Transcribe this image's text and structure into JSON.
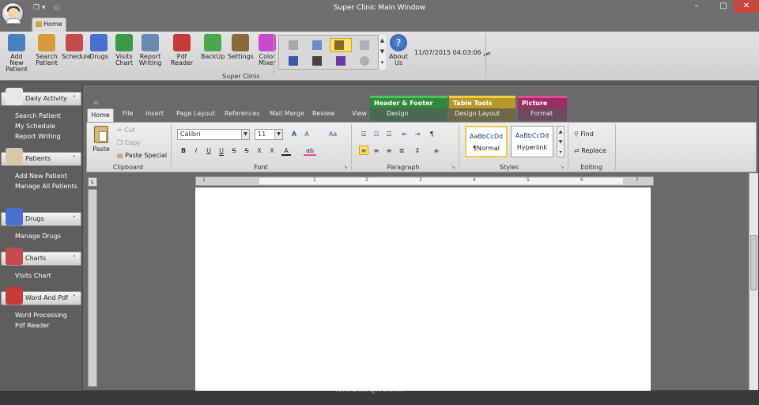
{
  "window": {
    "title": "Super Clinic Main Window",
    "home_tab": "Home",
    "minimize": "–",
    "maximize": "□",
    "close": "✕",
    "qat_icons": "❐ ▾",
    "qat_pin": "▫"
  },
  "ribbon": {
    "buttons": [
      {
        "label1": "Add New",
        "label2": "Patient",
        "icon": "add-patient-icon",
        "color": "#4a7fc1"
      },
      {
        "label1": "Search",
        "label2": "Patient",
        "icon": "search-patient-icon",
        "color": "#d89a3a"
      },
      {
        "label1": "Schedule",
        "label2": "",
        "icon": "calendar-icon",
        "color": "#c84a4a"
      },
      {
        "label1": "Drugs",
        "label2": "",
        "icon": "syringe-icon",
        "color": "#4a6fd1"
      },
      {
        "label1": "Visits",
        "label2": "Chart",
        "icon": "chart-icon",
        "color": "#3a9a4a"
      },
      {
        "label1": "Report",
        "label2": "Writing",
        "icon": "report-icon",
        "color": "#6a8ab0"
      },
      {
        "label1": "Pdf Reader",
        "label2": "",
        "icon": "pdf-icon",
        "color": "#c83a3a"
      },
      {
        "label1": "BackUp",
        "label2": "",
        "icon": "backup-icon",
        "color": "#4aa84a"
      },
      {
        "label1": "Settings",
        "label2": "",
        "icon": "settings-icon",
        "color": "#8a6a3a"
      },
      {
        "label1": "Color",
        "label2": "Mixer",
        "icon": "color-wheel-icon",
        "color": "#c84ac8"
      }
    ],
    "group_label": "Super Clinic",
    "about": {
      "label1": "About",
      "label2": "Us"
    },
    "datetime": "11/07/2015 04:03:06 ص",
    "scroll_up": "▲",
    "scroll_down": "▼",
    "scroll_more": "▾"
  },
  "sidebar": {
    "sections": [
      {
        "title": "Daily Activity",
        "items": [
          "Search Patient",
          "My Schedule",
          "Report Writing"
        ]
      },
      {
        "title": "Patients",
        "items": [
          "Add New Patient",
          "Manage All Patients"
        ]
      },
      {
        "title": "Drugs",
        "items": [
          "Manage Drugs"
        ]
      },
      {
        "title": "Charts",
        "items": [
          "Visits Chart"
        ]
      },
      {
        "title": "Word And Pdf",
        "items": [
          "Word Processing",
          "Pdf Reader"
        ]
      }
    ],
    "collapse_glyph": "˄"
  },
  "word": {
    "context_tabs": {
      "header_footer": "Header & Footer Tools",
      "table": "Table Tools",
      "picture": "Picture Tools"
    },
    "tabs": [
      "Home",
      "File",
      "Insert",
      "Page Layout",
      "References",
      "Mail Merge",
      "Review",
      "View",
      "Design",
      "Design",
      "Layout",
      "Format"
    ],
    "clipboard": {
      "paste": "Paste",
      "cut": "Cut",
      "copy": "Copy",
      "paste_special": "Paste Special",
      "label": "Clipboard"
    },
    "font": {
      "name": "Calibri",
      "size": "11",
      "label": "Font",
      "grow": "A",
      "shrink": "A",
      "case": "Aa",
      "bold": "B",
      "italic": "I",
      "underline": "U",
      "double_underline": "U",
      "strike": "S",
      "dstrike": "S",
      "sub": "X",
      "sup": "X",
      "font_color": "A",
      "highlight": "ab"
    },
    "paragraph": {
      "label": "Paragraph",
      "pilcrow": "¶"
    },
    "styles": {
      "normal_sample": "AaBbCcDd",
      "normal": "¶Normal",
      "hyperlink_sample": "AaBbCcDd",
      "hyperlink": "Hyperlink",
      "label": "Styles"
    },
    "editing": {
      "find": "Find",
      "replace": "Replace",
      "label": "Editing"
    },
    "ruler_corner": "L",
    "ruler_numbers": [
      "1",
      "1",
      "2",
      "3",
      "4",
      "5",
      "6",
      "7"
    ],
    "launcher": "↘"
  },
  "watermark": {
    "arabic": "مستقل",
    "latin": "mostaql.com"
  }
}
